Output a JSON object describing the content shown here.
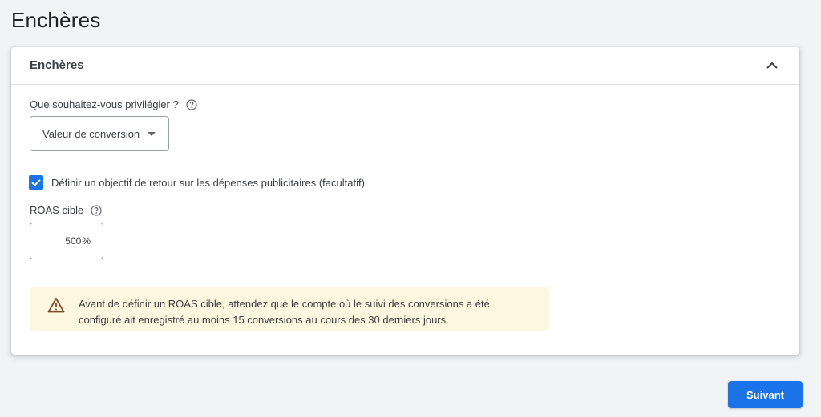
{
  "page": {
    "title": "Enchères"
  },
  "card": {
    "header_title": "Enchères",
    "collapse_icon": "chevron-up-icon",
    "question_label": "Que souhaitez-vous privilégier ?",
    "select": {
      "selected_value": "Valeur de conversion"
    },
    "checkbox": {
      "checked": true,
      "label": "Définir un objectif de retour sur les dépenses publicitaires (facultatif)"
    },
    "roas": {
      "label": "ROAS cible",
      "value": "500",
      "unit": "%"
    },
    "warning": {
      "icon": "warning-icon",
      "line1": "Avant de définir un ROAS cible, attendez que le compte où le suivi des conversions a été",
      "line2": "configuré ait enregistré au moins 15 conversions au cours des 30 derniers jours."
    }
  },
  "footer": {
    "next_label": "Suivant"
  },
  "colors": {
    "accent": "#1a73e8",
    "warning_bg": "#fef7e0",
    "background": "#f1f3f4"
  }
}
